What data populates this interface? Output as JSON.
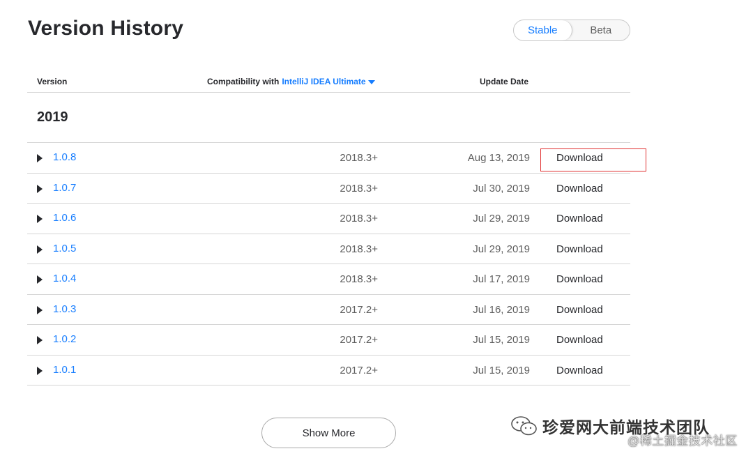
{
  "page": {
    "title": "Version History"
  },
  "channel_toggle": {
    "options": [
      {
        "label": "Stable",
        "active": true
      },
      {
        "label": "Beta",
        "active": false
      }
    ]
  },
  "table": {
    "headers": {
      "version": "Version",
      "compat_prefix": "Compatibility with",
      "compat_product": "IntelliJ IDEA Ultimate",
      "update_date": "Update Date"
    },
    "year": "2019",
    "rows": [
      {
        "version": "1.0.8",
        "compat": "2018.3+",
        "date": "Aug 13, 2019",
        "download": "Download"
      },
      {
        "version": "1.0.7",
        "compat": "2018.3+",
        "date": "Jul 30, 2019",
        "download": "Download"
      },
      {
        "version": "1.0.6",
        "compat": "2018.3+",
        "date": "Jul 29, 2019",
        "download": "Download"
      },
      {
        "version": "1.0.5",
        "compat": "2018.3+",
        "date": "Jul 29, 2019",
        "download": "Download"
      },
      {
        "version": "1.0.4",
        "compat": "2018.3+",
        "date": "Jul 17, 2019",
        "download": "Download"
      },
      {
        "version": "1.0.3",
        "compat": "2017.2+",
        "date": "Jul 16, 2019",
        "download": "Download"
      },
      {
        "version": "1.0.2",
        "compat": "2017.2+",
        "date": "Jul 15, 2019",
        "download": "Download"
      },
      {
        "version": "1.0.1",
        "compat": "2017.2+",
        "date": "Jul 15, 2019",
        "download": "Download"
      }
    ]
  },
  "show_more": {
    "label": "Show More"
  },
  "watermark": {
    "icon": "wechat-icon",
    "title": "珍爱网大前端技术团队",
    "sub": "@稀土掘金技术社区"
  },
  "colors": {
    "accent": "#167dff",
    "text": "#27282c",
    "muted": "#5e5e5e",
    "divider": "#d6d6d6",
    "highlight": "#e03131"
  }
}
